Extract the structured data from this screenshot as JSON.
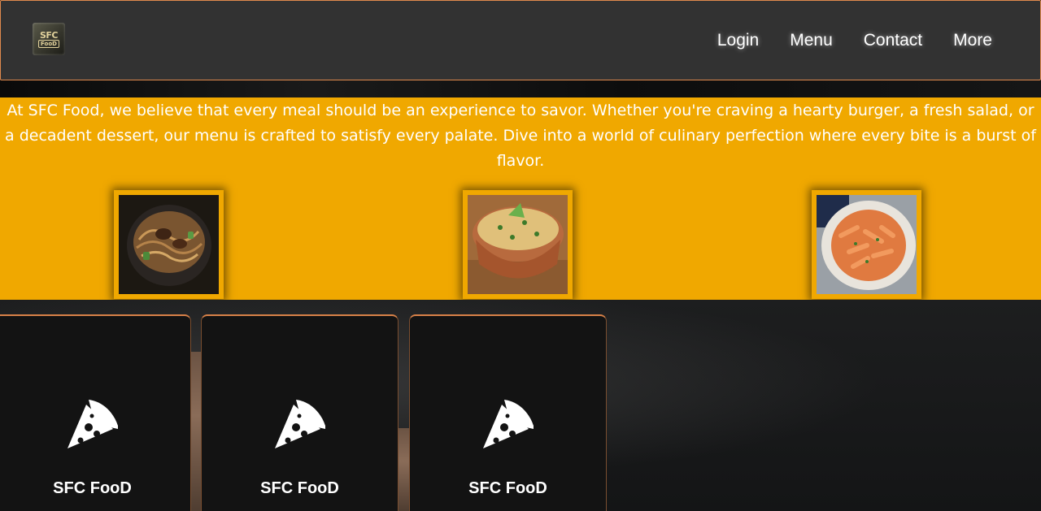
{
  "header": {
    "logo_line1": "SFC",
    "logo_line2": "FooD",
    "nav": [
      "Login",
      "Menu",
      "Contact",
      "More"
    ]
  },
  "hero": {
    "intro": "At SFC Food, we believe that every meal should be an experience to savor. Whether you're craving a hearty burger, a fresh salad, or a decadent dessert, our menu is crafted to satisfy every palate. Dive into a world of culinary perfection where every bite is a burst of flavor.",
    "images": [
      "noodle-bowl-image",
      "pulao-pot-image",
      "pasta-plate-image"
    ]
  },
  "cards": [
    {
      "icon": "pizza-slice-icon",
      "title": "SFC FooD"
    },
    {
      "icon": "pizza-slice-icon",
      "title": "SFC FooD"
    },
    {
      "icon": "pizza-slice-icon",
      "title": "SFC FooD"
    }
  ],
  "colors": {
    "accent": "#f0a800",
    "header_bg": "#323232",
    "header_border": "#e08a4e",
    "card_bg": "#131313"
  }
}
